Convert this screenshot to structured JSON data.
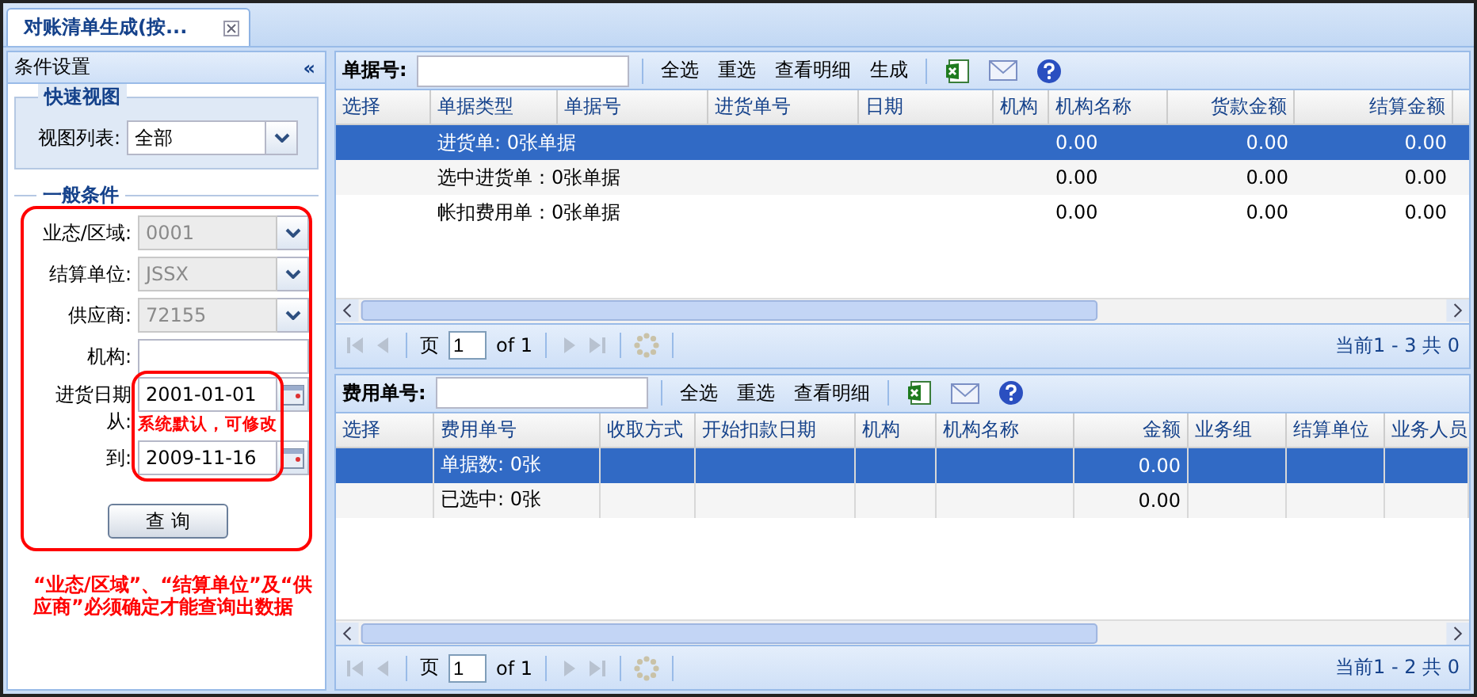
{
  "tab": {
    "label": "对账清单生成(按..."
  },
  "left_panel": {
    "title": "条件设置",
    "collapse": "«",
    "quick_view": {
      "legend": "快速视图",
      "fields": [
        {
          "kind": "select",
          "label": "视图列表:",
          "value": "全部",
          "disabled": false
        }
      ]
    },
    "general": {
      "legend": "一般条件",
      "fields": [
        {
          "kind": "select",
          "label": "业态/区域:",
          "value": "0001",
          "disabled": true
        },
        {
          "kind": "select",
          "label": "结算单位:",
          "value": "JSSX",
          "disabled": true
        },
        {
          "kind": "select",
          "label": "供应商:",
          "value": "72155",
          "disabled": true
        },
        {
          "kind": "text",
          "label": "机构:",
          "disabled": false
        },
        {
          "kind": "date",
          "label": "进货日期",
          "sublabel": "从:",
          "value": "2001-01-01",
          "disabled": false
        },
        {
          "kind": "date",
          "label": "到:",
          "value": "2009-11-16",
          "disabled": false
        }
      ]
    },
    "query_button": "查 询",
    "date_annotation": "系统默认，可修改",
    "note": "“业态/区域”、“结算单位”及“供应商”必须确定才能查询出数据"
  },
  "top_grid": {
    "search_label": "单据号:",
    "actions": [
      "全选",
      "重选",
      "查看明细",
      "生成"
    ],
    "columns": [
      "选择",
      "单据类型",
      "单据号",
      "进货单号",
      "日期",
      "机构",
      "机构名称",
      "货款金额",
      "结算金额"
    ],
    "rows": [
      {
        "selected": true,
        "cells": [
          "",
          "进货单: 0张单据",
          "",
          "",
          "",
          "",
          "0.00",
          "0.00",
          "0.00"
        ]
      },
      {
        "selected": false,
        "cells": [
          "",
          "选中进货单：0张单据",
          "",
          "",
          "",
          "",
          "0.00",
          "0.00",
          "0.00"
        ]
      },
      {
        "selected": false,
        "cells": [
          "",
          "帐扣费用单：0张单据",
          "",
          "",
          "",
          "",
          "0.00",
          "0.00",
          "0.00"
        ]
      }
    ],
    "pager": {
      "page_label": "页",
      "page": "1",
      "of": "of 1",
      "status": "当前1 - 3 共 0"
    }
  },
  "bottom_grid": {
    "search_label": "费用单号:",
    "actions": [
      "全选",
      "重选",
      "查看明细"
    ],
    "columns": [
      "选择",
      "费用单号",
      "收取方式",
      "开始扣款日期",
      "机构",
      "机构名称",
      "金额",
      "业务组",
      "结算单位",
      "业务人员"
    ],
    "rows": [
      {
        "selected": true,
        "cells": [
          "",
          "单据数: 0张",
          "",
          "",
          "",
          "",
          "0.00",
          "",
          "",
          ""
        ]
      },
      {
        "selected": false,
        "cells": [
          "",
          "已选中: 0张",
          "",
          "",
          "",
          "",
          "0.00",
          "",
          "",
          ""
        ]
      }
    ],
    "pager": {
      "page_label": "页",
      "page": "1",
      "of": "of 1",
      "status": "当前1 - 2 共 0"
    }
  }
}
